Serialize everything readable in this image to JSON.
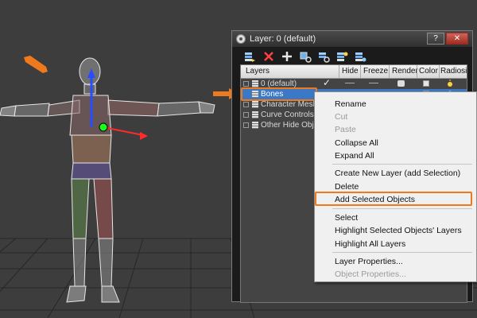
{
  "window": {
    "title": "Layer: 0 (default)",
    "help_label": "?",
    "close_label": "✕"
  },
  "toolbar": {
    "icons": [
      "layer-stack-icon",
      "delete-icon",
      "add-icon",
      "select-objects-icon",
      "highlight-icon",
      "hide-icon",
      "freeze-icon"
    ]
  },
  "table": {
    "columns": [
      "Layers",
      "Hide",
      "Freeze",
      "Render",
      "Color",
      "Radiosity"
    ],
    "rows": [
      {
        "name": "0 (default)",
        "active_mark": "✓",
        "color": "#e6e6e6"
      },
      {
        "name": "Bones",
        "selected": true,
        "color": "#7fe07f"
      },
      {
        "name": "Character Mesh"
      },
      {
        "name": "Curve Controls"
      },
      {
        "name": "Other Hide Objects"
      }
    ]
  },
  "context_menu": {
    "items": [
      {
        "label": "Rename",
        "enabled": true
      },
      {
        "label": "Cut",
        "enabled": false
      },
      {
        "label": "Paste",
        "enabled": false
      },
      {
        "label": "Collapse All",
        "enabled": true
      },
      {
        "label": "Expand All",
        "enabled": true
      },
      {
        "label": "Create New Layer (add Selection)",
        "enabled": true
      },
      {
        "label": "Delete",
        "enabled": true
      },
      {
        "label": "Add Selected Objects",
        "enabled": true,
        "highlighted": true
      },
      {
        "label": "Select",
        "enabled": true
      },
      {
        "label": "Highlight Selected Objects' Layers",
        "enabled": true
      },
      {
        "label": "Highlight All Layers",
        "enabled": true
      },
      {
        "label": "Layer Properties...",
        "enabled": true
      },
      {
        "label": "Object Properties...",
        "enabled": false
      }
    ]
  },
  "colors": {
    "accent": "#ef7a1e",
    "selection": "#3b78c6",
    "viewport_bg": "#3d3d3d"
  }
}
